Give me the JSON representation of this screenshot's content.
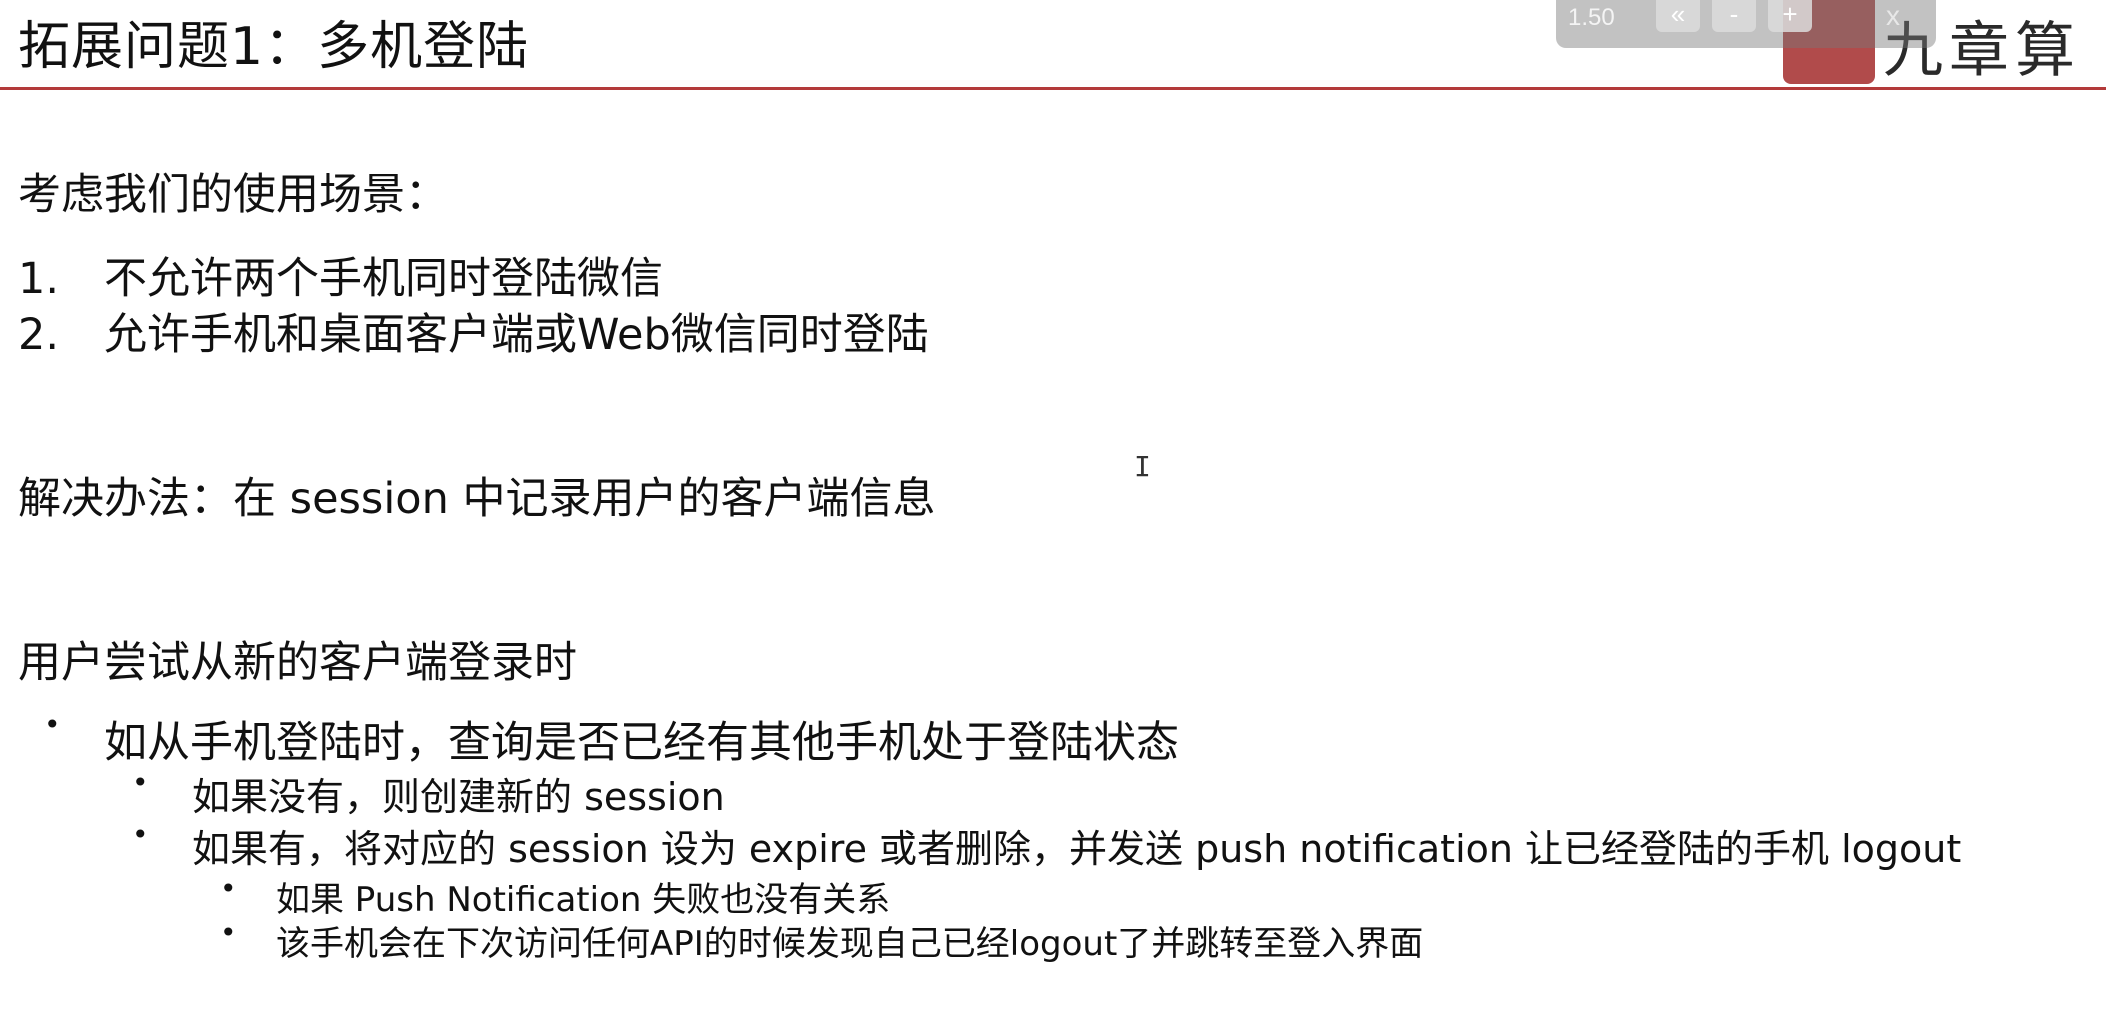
{
  "slide": {
    "title": "拓展问题1：多机登陆",
    "scenario_heading": "考虑我们的使用场景：",
    "scenarios": [
      {
        "number": "1.",
        "text": "不允许两个手机同时登陆微信"
      },
      {
        "number": "2.",
        "text": "允许手机和桌面客户端或Web微信同时登陆"
      }
    ],
    "solution": "解决办法：在 session 中记录用户的客户端信息",
    "login_heading": "用户尝试从新的客户端登录时",
    "bullet_l1": "如从手机登陆时，查询是否已经有其他手机处于登陆状态",
    "bullets_l2": [
      "如果没有，则创建新的 session",
      "如果有，将对应的 session 设为 expire 或者删除，并发送 push notification 让已经登陆的手机 logout"
    ],
    "bullets_l3": [
      "如果 Push Notification 失败也没有关系",
      "该手机会在下次访问任何API的时候发现自己已经logout了并跳转至登入界面"
    ]
  },
  "logo": {
    "seal_text": "九章算法",
    "script_text": "九章算"
  },
  "toolbar": {
    "zoom": "1.50",
    "back_label": "«",
    "minus_label": "-",
    "plus_label": "+",
    "close_label": "x"
  },
  "colors": {
    "title_rule": "#b33a3a",
    "seal": "#a32b2b"
  },
  "icons": {
    "cursor": "text-cursor-icon"
  }
}
